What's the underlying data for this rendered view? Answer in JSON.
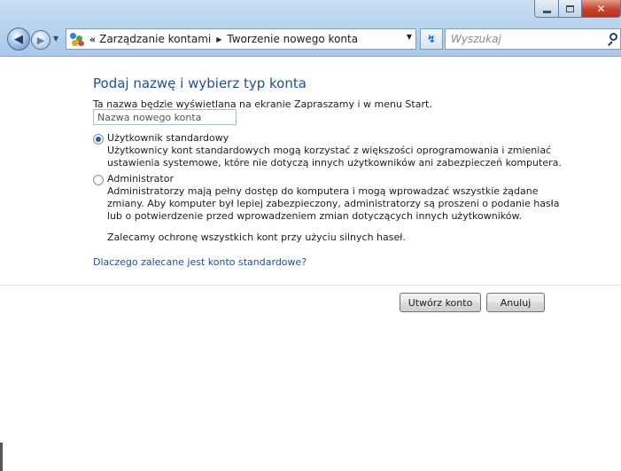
{
  "window": {
    "controls": {
      "minimize_icon": "minimize-icon",
      "maximize_icon": "maximize-icon",
      "close_icon": "close-icon"
    }
  },
  "navigation": {
    "back_icon": "back-arrow-icon",
    "forward_icon": "forward-arrow-icon",
    "recent_icon": "recent-pages-dropdown-icon"
  },
  "address_bar": {
    "overflow": "«",
    "breadcrumbs": [
      "Zarządzanie kontami",
      "Tworzenie nowego konta"
    ],
    "dropdown_icon": "dropdown-arrow-icon",
    "refresh_icon": "refresh-icon"
  },
  "search": {
    "placeholder": "Wyszukaj",
    "icon": "search-icon"
  },
  "form": {
    "heading": "Podaj nazwę i wybierz typ konta",
    "subtext": "Ta nazwa będzie wyświetlana na ekranie Zapraszamy i w menu Start.",
    "name_input": {
      "placeholder": "Nazwa nowego konta",
      "value": ""
    },
    "options": [
      {
        "label": "Użytkownik standardowy",
        "selected": true,
        "description": "Użytkownicy kont standardowych mogą korzystać z większości oprogramowania i zmieniać ustawienia systemowe, które nie dotyczą innych użytkowników ani zabezpieczeń komputera."
      },
      {
        "label": "Administrator",
        "selected": false,
        "description": "Administratorzy mają pełny dostęp do komputera i mogą wprowadzać wszystkie żądane zmiany. Aby komputer był lepiej zabezpieczony, administratorzy są proszeni o podanie hasła lub o potwierdzenie przed wprowadzeniem zmian dotyczących innych użytkowników."
      }
    ],
    "recommendation": "Zalecamy ochronę wszystkich kont przy użyciu silnych haseł.",
    "link": "Dlaczego zalecane jest konto standardowe?"
  },
  "buttons": {
    "create": "Utwórz konto",
    "cancel": "Anuluj"
  },
  "colors": {
    "heading": "#1f4e9a",
    "link": "#1f4fa3",
    "chrome": "#bcd5ef",
    "close_button": "#c2442d"
  }
}
